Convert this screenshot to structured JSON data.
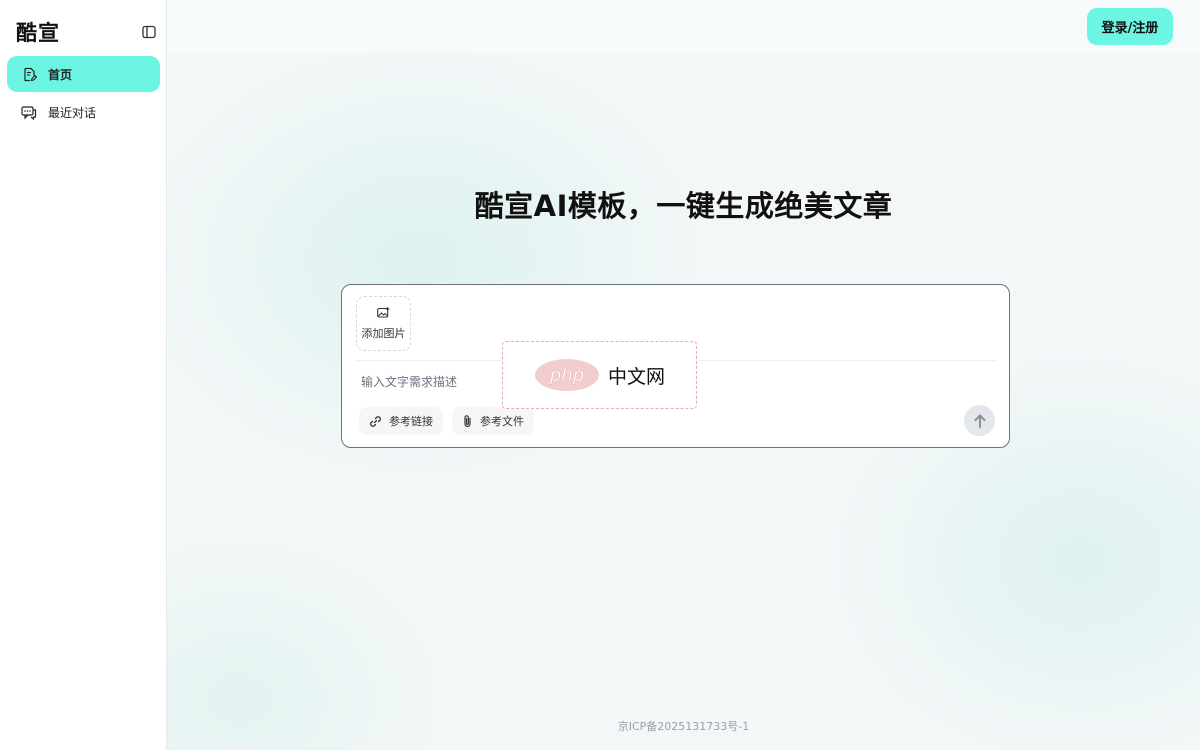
{
  "sidebar": {
    "brand": "酷宣",
    "items": [
      {
        "label": "首页",
        "icon": "edit-document-icon",
        "active": true
      },
      {
        "label": "最近对话",
        "icon": "chat-bubbles-icon",
        "active": false
      }
    ]
  },
  "topbar": {
    "login_label": "登录/注册"
  },
  "main": {
    "headline": "酷宣AI模板，一键生成绝美文章"
  },
  "composer": {
    "add_image_label": "添加图片",
    "input_placeholder": "输入文字需求描述",
    "input_value": "",
    "chips": [
      {
        "label": "参考链接",
        "icon": "link-icon"
      },
      {
        "label": "参考文件",
        "icon": "paperclip-icon"
      }
    ],
    "send_icon": "arrow-up-icon"
  },
  "watermark": {
    "logo_text": "php",
    "text": "中文网"
  },
  "footer": {
    "icp": "京ICP备2025131733号-1"
  },
  "colors": {
    "accent": "#6df5e3",
    "border": "#6b7280",
    "muted_text": "#9aa0a6"
  }
}
